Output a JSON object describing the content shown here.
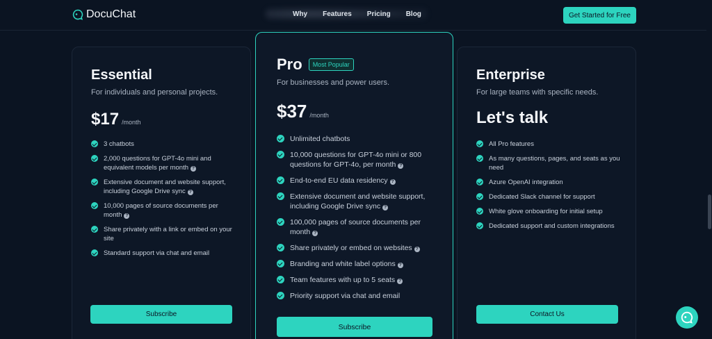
{
  "header": {
    "brand": "DocuChat",
    "nav": [
      "Why",
      "Features",
      "Pricing",
      "Blog"
    ],
    "cta": "Get Started for Free"
  },
  "plans": [
    {
      "name": "Essential",
      "subtitle": "For individuals and personal projects.",
      "price": "$17",
      "period": "/month",
      "features": [
        {
          "text": "3 chatbots",
          "help": false
        },
        {
          "text": "2,000 questions for GPT-4o mini and equivalent models per month",
          "help": true
        },
        {
          "text": "Extensive document and website support, including Google Drive sync",
          "help": true
        },
        {
          "text": "10,000 pages of source documents per month",
          "help": true
        },
        {
          "text": "Share privately with a link or embed on your site",
          "help": false
        },
        {
          "text": "Standard support via chat and email",
          "help": false
        }
      ],
      "button": "Subscribe"
    },
    {
      "name": "Pro",
      "badge": "Most Popular",
      "subtitle": "For businesses and power users.",
      "price": "$37",
      "period": "/month",
      "features": [
        {
          "text": "Unlimited chatbots",
          "help": false
        },
        {
          "text": "10,000 questions for GPT-4o mini or 800 questions for GPT-4o, per month",
          "help": true
        },
        {
          "text": "End-to-end EU data residency",
          "help": true
        },
        {
          "text": "Extensive document and website support, including Google Drive sync",
          "help": true
        },
        {
          "text": "100,000 pages of source documents per month",
          "help": true
        },
        {
          "text": "Share privately or embed on websites",
          "help": true
        },
        {
          "text": "Branding and white label options",
          "help": true
        },
        {
          "text": "Team features with up to 5 seats",
          "help": true
        },
        {
          "text": "Priority support via chat and email",
          "help": false
        }
      ],
      "button": "Subscribe"
    },
    {
      "name": "Enterprise",
      "subtitle": "For large teams with specific needs.",
      "price_text": "Let's talk",
      "features": [
        {
          "text": "All Pro features",
          "help": false
        },
        {
          "text": "As many questions, pages, and seats as you need",
          "help": false
        },
        {
          "text": "Azure OpenAI integration",
          "help": false
        },
        {
          "text": "Dedicated Slack channel for support",
          "help": false
        },
        {
          "text": "White glove onboarding for initial setup",
          "help": false
        },
        {
          "text": "Dedicated support and custom integrations",
          "help": false
        }
      ],
      "button": "Contact Us"
    }
  ],
  "help_glyph": "?",
  "colors": {
    "accent": "#2dd4bf",
    "background": "#0b1422"
  }
}
